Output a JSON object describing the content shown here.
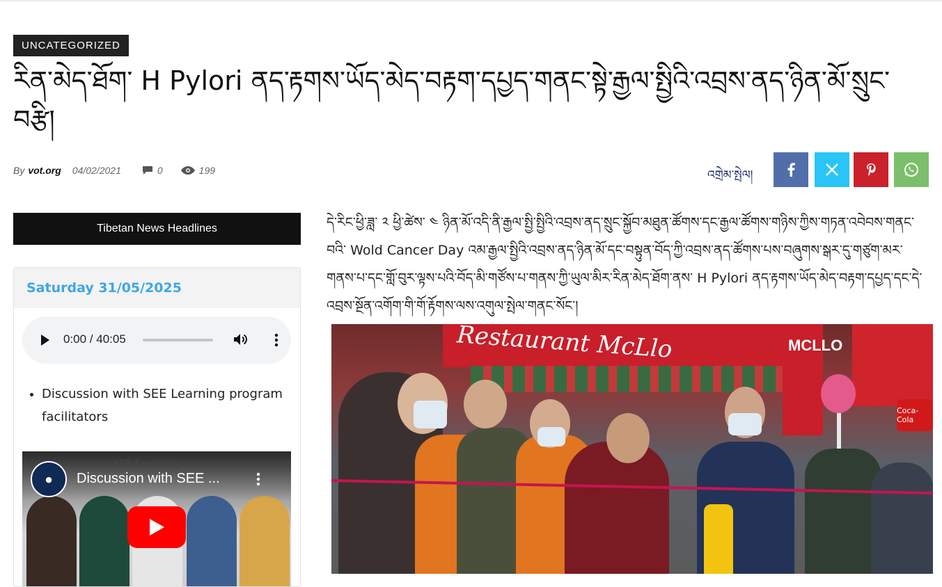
{
  "category": "UNCATEGORIZED",
  "article": {
    "title": "རིན་མེད་ཐོག་ H Pylori ནད་རྟགས་ཡོད་མེད་བརྟག་དཔྱད་གནང་སྟེ་རྒྱལ་སྤྱིའི་འབྲས་ནད་ཉིན་མོ་སྲུང་བརྩི།",
    "by_label": "By",
    "author": "vot.org",
    "date": "04/02/2021",
    "comments": "0",
    "views": "199",
    "body": "དེ་རིང་ཕྱི་ཟླ་ ༢ ཕྱི་ཚེས་ ༤ ཉིན་མོ་འདི་ནི་རྒྱལ་སྤྱི་སྤྱིའི་འབྲས་ནད་སྲུང་སྐྱོབ་མཐུན་ཚོགས་དང་རྒྱལ་ཚོགས་གཉིས་ཀྱིས་གཏན་འབེབས་གནང་བའི་ Wold Cancer Day འམ་རྒྱལ་སྤྱིའི་འབྲས་ནད་ཉིན་མོ་དང་བསྟུན་བོད་ཀྱི་འབྲས་ནད་ཚོགས་པས་བཞུགས་སྒར་དུ་གཙུག་མར་གནས་པ་དང་གློ་བུར་ལྟས་པའི་བོད་མི་གཙོས་པ་གནས་ཀྱི་ཡུལ་མིར་རིན་མེད་ཐོག་ནས་ H Pylori ནད་རྟགས་ཡོད་མེད་བརྟག་དཔྱད་དང་དེ་འབྲས་སྔོན་འགོག་གི་གོ་རྟོགས་ལས་འགུལ་སྤེལ་གནང་སོང་།"
  },
  "share": {
    "label": "འགྲེམ་སྤེལ།",
    "buttons": [
      "facebook",
      "x",
      "pinterest",
      "whatsapp"
    ]
  },
  "sidebar": {
    "header": "Tibetan News Headlines",
    "date": "Saturday 31/05/2025",
    "audio": {
      "time": "0:00 / 40:05",
      "progress": 0
    },
    "playlist": [
      "Discussion with SEE Learning program facilitators"
    ],
    "video": {
      "title": "Discussion with SEE ...",
      "brand": "SEE Learning"
    }
  },
  "photo": {
    "sign": "Restaurant McLlo",
    "vertical_sign": "MCLLO",
    "coke": "Coca-Cola"
  },
  "colors": {
    "badge_bg": "#222222",
    "date_text": "#3fa6e8",
    "facebook": "#516eab",
    "twitter": "#29c5f6",
    "pinterest": "#ca212a",
    "whatsapp": "#7bbf6a"
  }
}
